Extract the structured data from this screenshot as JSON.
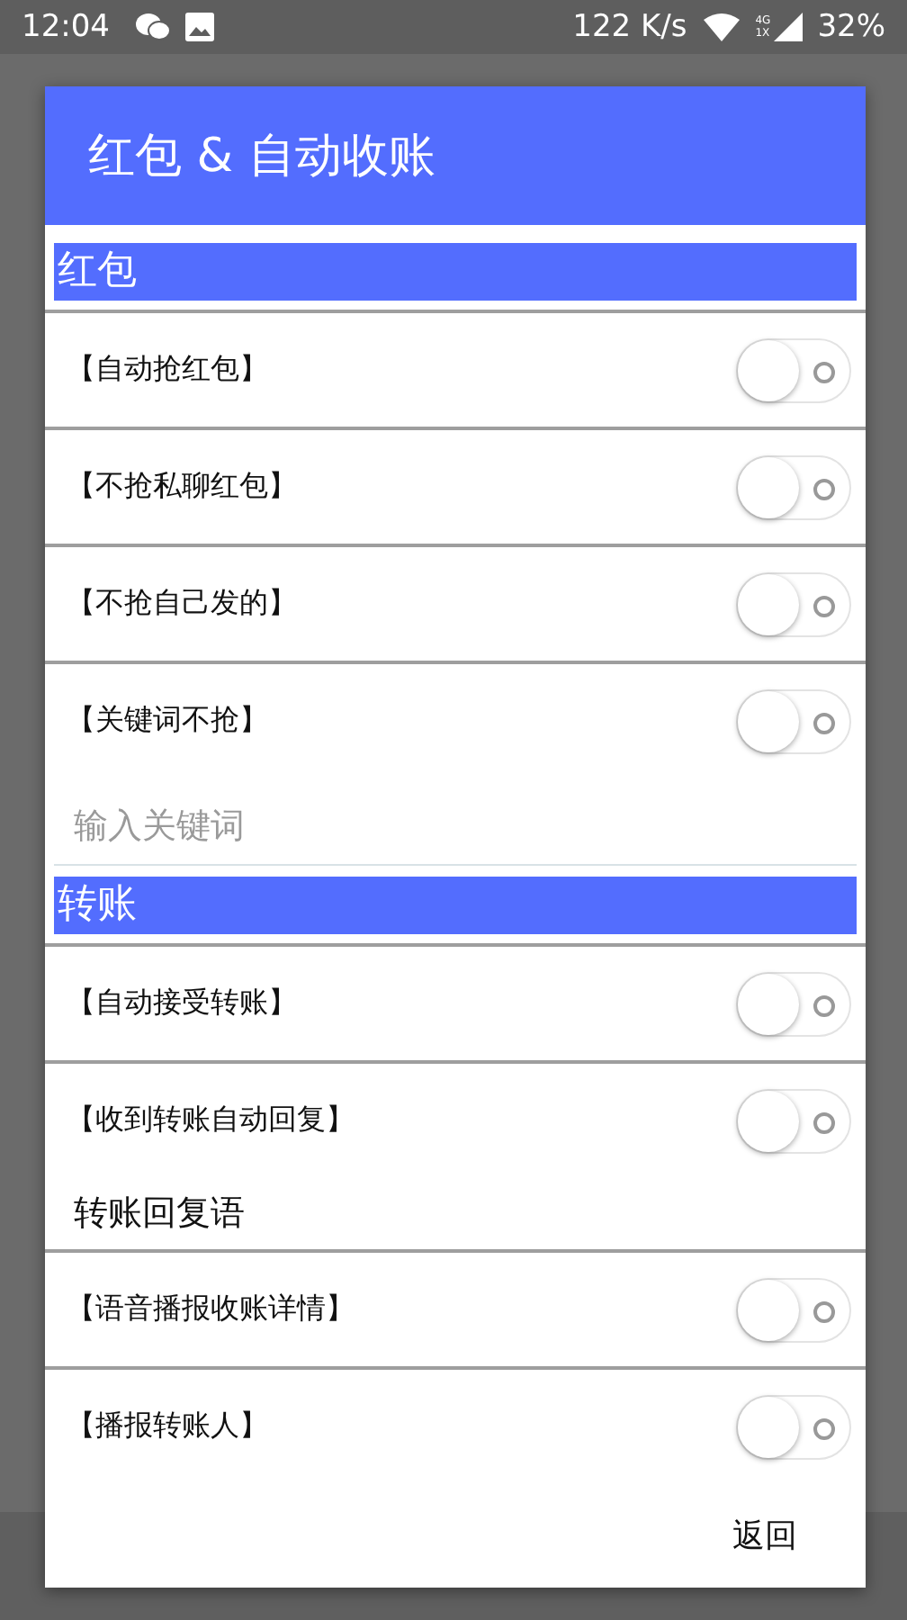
{
  "status_bar": {
    "time": "12:04",
    "speed": "122 K/s",
    "network_top": "4G",
    "network_bottom": "1X",
    "battery": "32%"
  },
  "dialog": {
    "title": "红包 & 自动收账",
    "sections": [
      {
        "title": "红包",
        "items": [
          {
            "kind": "switch",
            "label": "【自动抢红包】",
            "checked": false
          },
          {
            "kind": "switch",
            "label": "【不抢私聊红包】",
            "checked": false
          },
          {
            "kind": "switch",
            "label": "【不抢自己发的】",
            "checked": false
          },
          {
            "kind": "switch",
            "label": "【关键词不抢】",
            "checked": false
          },
          {
            "kind": "field",
            "placeholder": "输入关键词"
          }
        ]
      },
      {
        "title": "转账",
        "items": [
          {
            "kind": "switch",
            "label": "【自动接受转账】",
            "checked": false
          },
          {
            "kind": "switch",
            "label": "【收到转账自动回复】",
            "checked": false
          },
          {
            "kind": "field",
            "value": "转账回复语"
          },
          {
            "kind": "switch",
            "label": "【语音播报收账详情】",
            "checked": false
          },
          {
            "kind": "switch",
            "label": "【播报转账人】",
            "checked": false
          }
        ]
      }
    ],
    "button": "返回"
  }
}
